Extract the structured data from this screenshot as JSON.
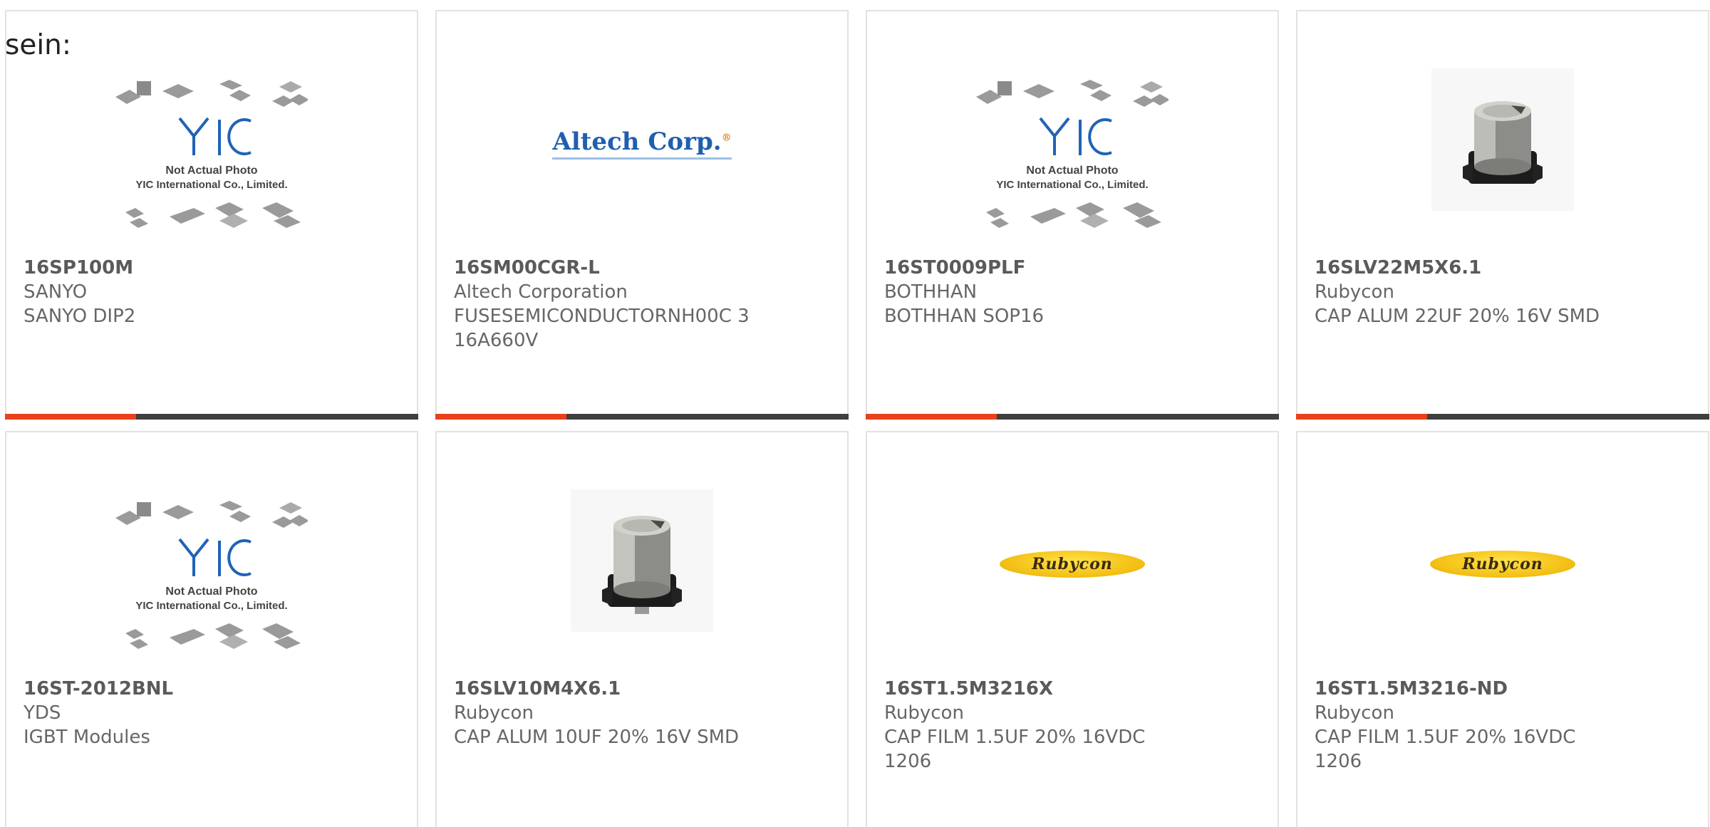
{
  "intro_text": "sein:",
  "colors": {
    "accent": "#e8421d",
    "bar": "#3f3f3f",
    "border": "#e2e2e2",
    "text": "#666666"
  },
  "yic_placeholder": {
    "line1": "Not Actual Photo",
    "line2": "YIC International Co., Limited."
  },
  "products": [
    {
      "part": "16SP100M",
      "maker": "SANYO",
      "desc": "SANYO DIP2",
      "image": "yic-placeholder"
    },
    {
      "part": "16SM00CGR-L",
      "maker": "Altech Corporation",
      "desc": "FUSESEMICONDUCTORNH00C 3 16A660V",
      "image": "altech-logo",
      "logo_text": "Altech Corp."
    },
    {
      "part": "16ST0009PLF",
      "maker": "BOTHHAN",
      "desc": "BOTHHAN SOP16",
      "image": "yic-placeholder"
    },
    {
      "part": "16SLV22M5X6.1",
      "maker": "Rubycon",
      "desc": "CAP ALUM 22UF 20% 16V SMD",
      "image": "capacitor-photo"
    },
    {
      "part": "16ST-2012BNL",
      "maker": "YDS",
      "desc": "IGBT Modules",
      "image": "yic-placeholder"
    },
    {
      "part": "16SLV10M4X6.1",
      "maker": "Rubycon",
      "desc": "CAP ALUM 10UF 20% 16V SMD",
      "image": "capacitor-photo"
    },
    {
      "part": "16ST1.5M3216X",
      "maker": "Rubycon",
      "desc": "CAP FILM 1.5UF 20% 16VDC 1206",
      "image": "rubycon-logo",
      "logo_text": "Rubycon"
    },
    {
      "part": "16ST1.5M3216-ND",
      "maker": "Rubycon",
      "desc": "CAP FILM 1.5UF 20% 16VDC 1206",
      "image": "rubycon-logo",
      "logo_text": "Rubycon"
    }
  ]
}
